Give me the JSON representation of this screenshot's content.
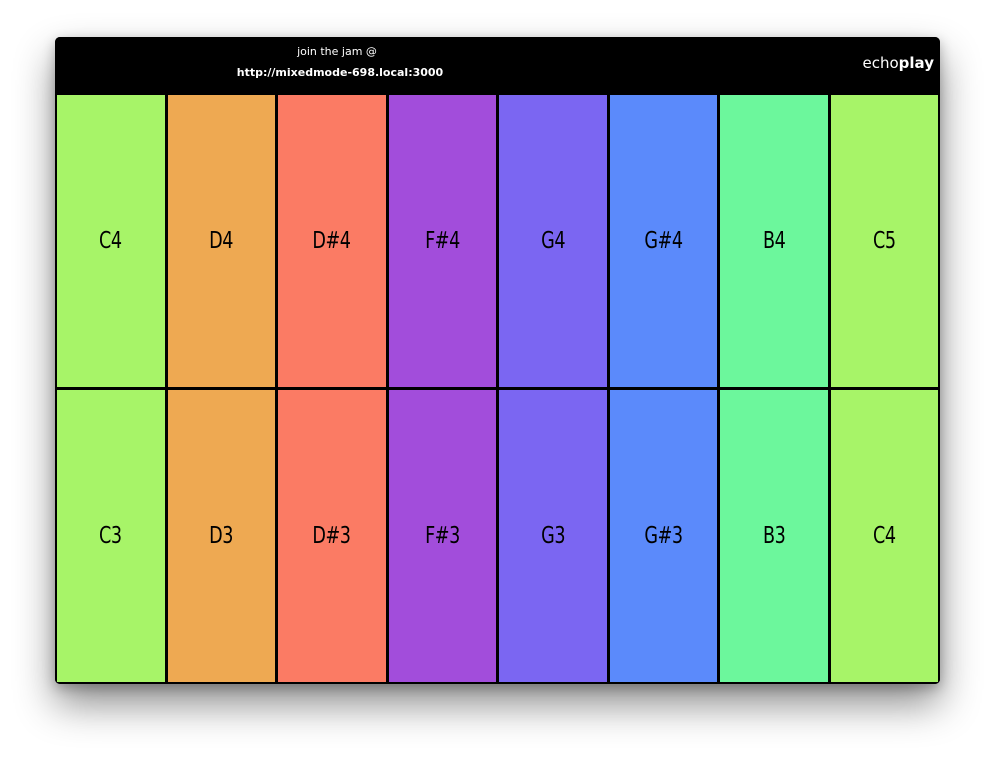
{
  "header": {
    "join_label": "join the jam @",
    "join_url": "http://mixedmode-698.local:3000",
    "brand_light": "echo",
    "brand_bold": "play"
  },
  "pads": [
    {
      "note": "C4",
      "color": "#a7f468"
    },
    {
      "note": "D4",
      "color": "#eea952"
    },
    {
      "note": "D#4",
      "color": "#fb7b64"
    },
    {
      "note": "F#4",
      "color": "#a24ddb"
    },
    {
      "note": "G4",
      "color": "#7b66f2"
    },
    {
      "note": "G#4",
      "color": "#5b8afb"
    },
    {
      "note": "B4",
      "color": "#6cf79c"
    },
    {
      "note": "C5",
      "color": "#a7f468"
    },
    {
      "note": "C3",
      "color": "#a7f468"
    },
    {
      "note": "D3",
      "color": "#eea952"
    },
    {
      "note": "D#3",
      "color": "#fb7b64"
    },
    {
      "note": "F#3",
      "color": "#a24ddb"
    },
    {
      "note": "G3",
      "color": "#7b66f2"
    },
    {
      "note": "G#3",
      "color": "#5b8afb"
    },
    {
      "note": "B3",
      "color": "#6cf79c"
    },
    {
      "note": "C4",
      "color": "#a7f468"
    }
  ]
}
